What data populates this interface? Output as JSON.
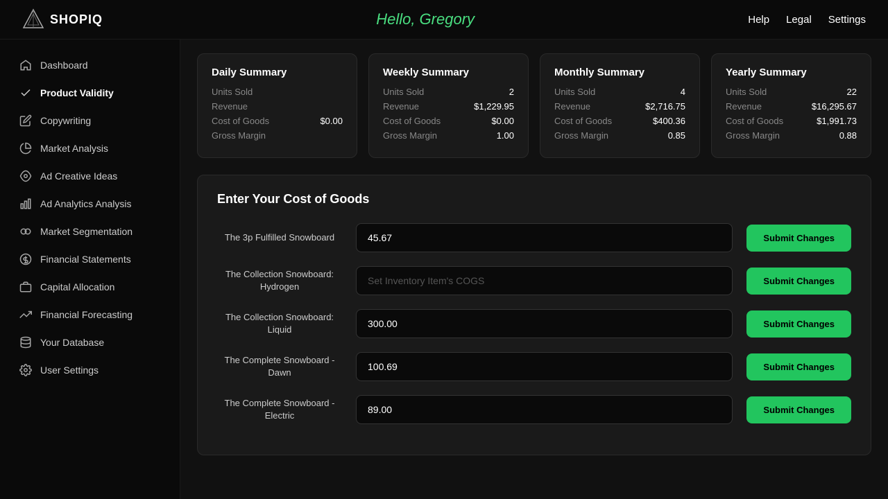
{
  "app": {
    "name": "SHOPIQ"
  },
  "header": {
    "greeting": "Hello, Gregory",
    "nav": [
      {
        "label": "Help"
      },
      {
        "label": "Legal"
      },
      {
        "label": "Settings"
      }
    ]
  },
  "sidebar": {
    "items": [
      {
        "id": "dashboard",
        "label": "Dashboard",
        "icon": "home"
      },
      {
        "id": "product-validity",
        "label": "Product Validity",
        "icon": "check"
      },
      {
        "id": "copywriting",
        "label": "Copywriting",
        "icon": "pencil"
      },
      {
        "id": "market-analysis",
        "label": "Market Analysis",
        "icon": "chart-pie"
      },
      {
        "id": "ad-creative-ideas",
        "label": "Ad Creative Ideas",
        "icon": "rocket"
      },
      {
        "id": "ad-analytics",
        "label": "Ad Analytics Analysis",
        "icon": "bar-chart"
      },
      {
        "id": "market-segmentation",
        "label": "Market Segmentation",
        "icon": "circles"
      },
      {
        "id": "financial-statements",
        "label": "Financial Statements",
        "icon": "dollar"
      },
      {
        "id": "capital-allocation",
        "label": "Capital Allocation",
        "icon": "briefcase"
      },
      {
        "id": "financial-forecasting",
        "label": "Financial Forecasting",
        "icon": "trending"
      },
      {
        "id": "your-database",
        "label": "Your Database",
        "icon": "database"
      },
      {
        "id": "user-settings",
        "label": "User Settings",
        "icon": "gear"
      }
    ]
  },
  "summary_cards": [
    {
      "title": "Daily Summary",
      "rows": [
        {
          "label": "Units Sold",
          "value": ""
        },
        {
          "label": "Revenue",
          "value": ""
        },
        {
          "label": "Cost of Goods",
          "value": "$0.00"
        },
        {
          "label": "Gross Margin",
          "value": ""
        }
      ]
    },
    {
      "title": "Weekly Summary",
      "rows": [
        {
          "label": "Units Sold",
          "value": "2"
        },
        {
          "label": "Revenue",
          "value": "$1,229.95"
        },
        {
          "label": "Cost of Goods",
          "value": "$0.00"
        },
        {
          "label": "Gross Margin",
          "value": "1.00"
        }
      ]
    },
    {
      "title": "Monthly Summary",
      "rows": [
        {
          "label": "Units Sold",
          "value": "4"
        },
        {
          "label": "Revenue",
          "value": "$2,716.75"
        },
        {
          "label": "Cost of Goods",
          "value": "$400.36"
        },
        {
          "label": "Gross Margin",
          "value": "0.85"
        }
      ]
    },
    {
      "title": "Yearly Summary",
      "rows": [
        {
          "label": "Units Sold",
          "value": "22"
        },
        {
          "label": "Revenue",
          "value": "$16,295.67"
        },
        {
          "label": "Cost of Goods",
          "value": "$1,991.73"
        },
        {
          "label": "Gross Margin",
          "value": "0.88"
        }
      ]
    }
  ],
  "cog_panel": {
    "title": "Enter Your Cost of Goods",
    "submit_label": "Submit Changes",
    "products": [
      {
        "name": "The 3p Fulfilled Snowboard",
        "value": "45.67",
        "placeholder": ""
      },
      {
        "name": "The Collection Snowboard: Hydrogen",
        "value": "",
        "placeholder": "Set Inventory Item's COGS"
      },
      {
        "name": "The Collection Snowboard: Liquid",
        "value": "300.00",
        "placeholder": ""
      },
      {
        "name": "The Complete Snowboard - Dawn",
        "value": "100.69",
        "placeholder": ""
      },
      {
        "name": "The Complete Snowboard - Electric",
        "value": "89.00",
        "placeholder": ""
      }
    ]
  }
}
